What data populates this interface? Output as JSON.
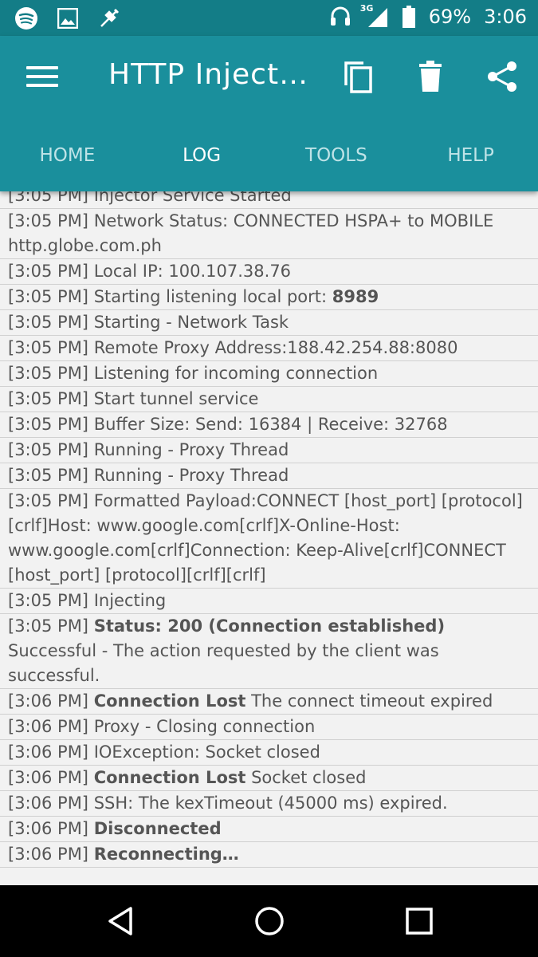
{
  "status_bar": {
    "left_icons": [
      "spotify-icon",
      "image-icon",
      "usb-icon"
    ],
    "network": "3G",
    "battery": "69%",
    "time": "3:06"
  },
  "app_bar": {
    "title": "HTTP Inject…",
    "actions": [
      "copy-icon",
      "delete-icon",
      "share-icon"
    ]
  },
  "tabs": [
    {
      "label": "HOME",
      "active": false
    },
    {
      "label": "LOG",
      "active": true
    },
    {
      "label": "TOOLS",
      "active": false
    },
    {
      "label": "HELP",
      "active": false
    }
  ],
  "log": [
    {
      "time": "[3:05 PM]",
      "parts": [
        {
          "t": " Injector Service Started"
        }
      ]
    },
    {
      "time": "[3:05 PM]",
      "parts": [
        {
          "t": " Network Status: CONNECTED HSPA+ to MOBILE http.globe.com.ph"
        }
      ]
    },
    {
      "time": "[3:05 PM]",
      "parts": [
        {
          "t": " Local IP: 100.107.38.76"
        }
      ]
    },
    {
      "time": "[3:05 PM]",
      "parts": [
        {
          "t": " Starting listening local port: "
        },
        {
          "t": "8989",
          "b": true
        }
      ]
    },
    {
      "time": "[3:05 PM]",
      "parts": [
        {
          "t": " Starting - Network Task"
        }
      ]
    },
    {
      "time": "[3:05 PM]",
      "parts": [
        {
          "t": " Remote Proxy Address:188.42.254.88:8080"
        }
      ]
    },
    {
      "time": "[3:05 PM]",
      "parts": [
        {
          "t": " Listening for incoming connection"
        }
      ]
    },
    {
      "time": "[3:05 PM]",
      "parts": [
        {
          "t": " Start tunnel service"
        }
      ]
    },
    {
      "time": "[3:05 PM]",
      "parts": [
        {
          "t": " Buffer Size: Send: 16384 | Receive: 32768"
        }
      ]
    },
    {
      "time": "[3:05 PM]",
      "parts": [
        {
          "t": " Running - Proxy Thread"
        }
      ]
    },
    {
      "time": "[3:05 PM]",
      "parts": [
        {
          "t": " Running - Proxy Thread"
        }
      ]
    },
    {
      "time": "[3:05 PM]",
      "parts": [
        {
          "t": " Formatted Payload:CONNECT [host_port] [protocol][crlf]Host: www.google.com[crlf]X-Online-Host: www.google.com[crlf]Connection: Keep-Alive[crlf]CONNECT [host_port] [protocol][crlf][crlf]"
        }
      ]
    },
    {
      "time": "[3:05 PM]",
      "parts": [
        {
          "t": " Injecting"
        }
      ]
    },
    {
      "time": "[3:05 PM]",
      "parts": [
        {
          "t": " "
        },
        {
          "t": "Status: 200 (Connection established)",
          "b": true
        },
        {
          "t": " Successful - The action requested by the client was successful."
        }
      ]
    },
    {
      "time": "[3:06 PM]",
      "parts": [
        {
          "t": " "
        },
        {
          "t": "Connection Lost",
          "b": true
        },
        {
          "t": " The connect timeout expired"
        }
      ]
    },
    {
      "time": "[3:06 PM]",
      "parts": [
        {
          "t": " Proxy - Closing connection"
        }
      ]
    },
    {
      "time": "[3:06 PM]",
      "parts": [
        {
          "t": " IOException: Socket closed"
        }
      ]
    },
    {
      "time": "[3:06 PM]",
      "parts": [
        {
          "t": " "
        },
        {
          "t": "Connection Lost",
          "b": true
        },
        {
          "t": " Socket closed"
        }
      ]
    },
    {
      "time": "[3:06 PM]",
      "parts": [
        {
          "t": " SSH: The kexTimeout (45000 ms) expired."
        }
      ]
    },
    {
      "time": "[3:06 PM]",
      "parts": [
        {
          "t": " "
        },
        {
          "t": "Disconnected",
          "b": true
        }
      ]
    },
    {
      "time": "[3:06 PM]",
      "parts": [
        {
          "t": " "
        },
        {
          "t": "Reconnecting…",
          "b": true
        }
      ]
    }
  ],
  "nav_bar": [
    "back-icon",
    "home-icon",
    "recents-icon"
  ],
  "colors": {
    "status_bar": "#137d87",
    "app_bar": "#1a8f9c",
    "log_bg": "#f2f2f2",
    "text": "#555555"
  }
}
